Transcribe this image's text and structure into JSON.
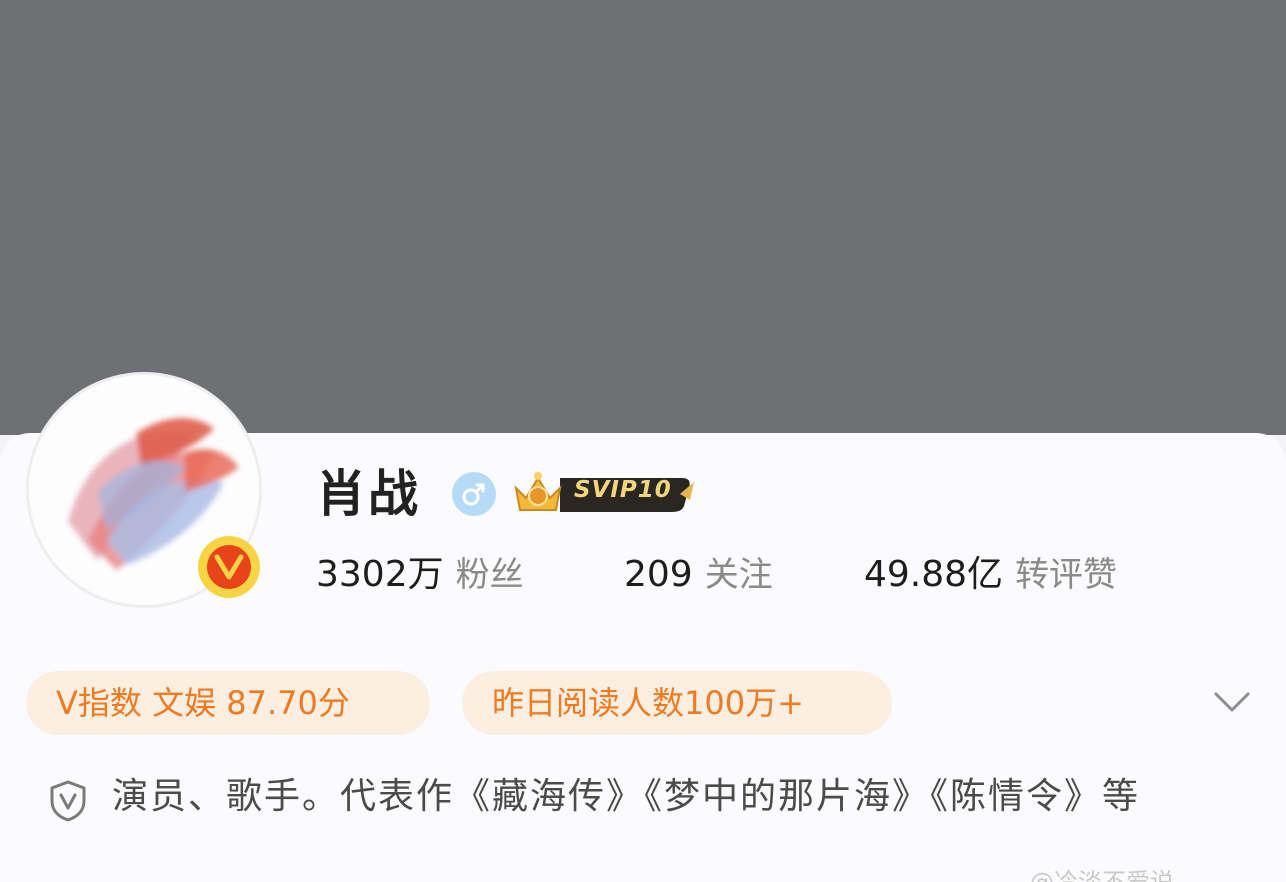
{
  "profile": {
    "name": "肖战",
    "gender_icon": "male-symbol",
    "svip_label": "SVIP10",
    "verified_badge": "V",
    "colors": {
      "cover": "#6f7073",
      "accent_orange": "#f07a1f",
      "pill_bg": "#fdeee2",
      "vip_gold": "#f4d57a"
    }
  },
  "stats": [
    {
      "value": "3302万",
      "label": "粉丝"
    },
    {
      "value": "209",
      "label": "关注"
    },
    {
      "value": "49.88亿",
      "label": "转评赞"
    }
  ],
  "tags": {
    "v_index": "V指数 文娱 87.70分",
    "yesterday_reads": "昨日阅读人数100万+"
  },
  "bio": "演员、歌手。代表作《藏海传》《梦中的那片海》《陈情令》等",
  "watermark": "@冷淡不爱说"
}
